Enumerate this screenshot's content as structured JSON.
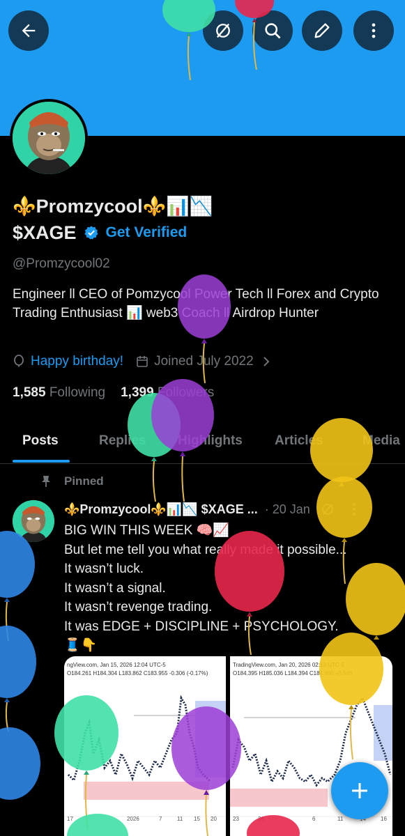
{
  "header": {
    "back_icon": "arrow-left-icon",
    "grok_icon": "slash-circle-icon",
    "search_icon": "search-icon",
    "edit_icon": "pencil-icon",
    "more_icon": "more-vertical-icon"
  },
  "profile": {
    "display_name": "⚜️Promzycool⚜️📊📉",
    "ticker": "$XAGE",
    "get_verified": "Get Verified",
    "handle": "@Promzycool02",
    "bio": "Engineer ll CEO of Pomzycool Power Tech ll Forex and Crypto Trading Enthusiast 📊 web3 Coach ll Airdrop Hunter",
    "birthday_link": "Happy birthday!",
    "joined": "Joined July 2022",
    "following_count": "1,585",
    "following_label": "Following",
    "followers_count": "1,399",
    "followers_label": "Followers"
  },
  "tabs": [
    "Posts",
    "Replies",
    "Highlights",
    "Articles",
    "Media"
  ],
  "post": {
    "pinned_label": "Pinned",
    "author": "⚜️Promzycool⚜️📊📉 $XAGE ...",
    "date": "· 20 Jan",
    "lines": [
      "BIG WIN THIS WEEK 🧠📈",
      "But let me tell you what really made it possible...",
      "It wasn’t luck.",
      "It wasn’t a signal.",
      "It wasn’t revenge trading.",
      "It was EDGE + DISCIPLINE + PSYCHOLOGY.",
      "🧵👇"
    ],
    "chart1_header": "ngView.com, Jan 15, 2026 12:04 UTC-5",
    "chart1_ohlc": "O184.261 H184.304 L183.862 C183.955 -0.306 (-0.17%)",
    "chart1_xticks": [
      "17",
      "2026",
      "7",
      "11",
      "15",
      "20"
    ],
    "chart2_header": "TradingView.com, Jan 20, 2026 02:13 UTC-5",
    "chart2_ohlc": "O184.395 H185.036 L184.394 C184.960 +0.565",
    "chart2_xticks": [
      "23",
      "26",
      "6",
      "11",
      "14",
      "16"
    ]
  },
  "fab_icon": "plus-icon",
  "colors": {
    "accent": "#1d9bf0",
    "muted": "#71767b",
    "text": "#e7e9ea",
    "background": "#000000"
  }
}
